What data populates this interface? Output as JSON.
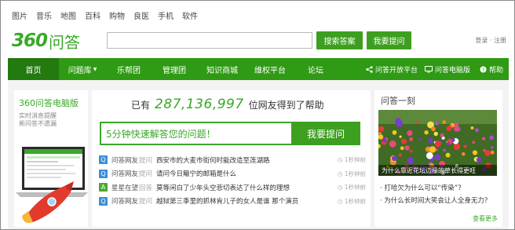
{
  "topnav": [
    "图片",
    "音乐",
    "地图",
    "百科",
    "购物",
    "良医",
    "手机",
    "软件"
  ],
  "logo": {
    "number": "360",
    "text": "问答"
  },
  "search_button": "搜索答案",
  "ask_button": "我要提问",
  "login": "登录 · 注册",
  "nav": {
    "home": "首页",
    "items": [
      "问题库",
      "乐帮团",
      "管理团",
      "知识商城",
      "维权平台",
      "论坛"
    ],
    "right": [
      "问答开放平台",
      "问答电脑版",
      "帮助"
    ]
  },
  "left": {
    "title": "360问答电脑版",
    "sub": "实时消息提醒\n新问答不遗漏"
  },
  "stats": {
    "prefix": "已有",
    "count": "287,136,997",
    "suffix": "位网友得到了帮助"
  },
  "ask_placeholder": "5分钟快速解答您的问题！",
  "ask_big": "我要提问",
  "questions": [
    {
      "tag": "Q",
      "user": "问答网友",
      "action": "提问",
      "title": "西安市的大麦市街何时能改造至莲湖路",
      "time": "1秒钟前",
      "color": "#3b8fd6"
    },
    {
      "tag": "Q",
      "user": "问答网友",
      "action": "提问",
      "title": "请问今日簸宁的邮箱是什么",
      "time": "1秒钟前",
      "color": "#3b8fd6"
    },
    {
      "tag": "A",
      "user": "星星在望",
      "action": "回答",
      "title": "莫等闲白了少年头空悲切表达了什么样的理想",
      "time": "1秒钟前",
      "color": "#4aa832"
    },
    {
      "tag": "Q",
      "user": "问答网友",
      "action": "提问",
      "title": "越狱第三季里的抓林肯儿子的女人是谁 那个演员",
      "time": "1秒钟前",
      "color": "#3b8fd6"
    }
  ],
  "right": {
    "title": "问答一刻",
    "caption": "为什么靠近花坛边缘的草长得更旺",
    "links": [
      "· 打哈欠为什么可以“传染”？",
      "· 为什么长时间大笑会让人全身无力？"
    ],
    "more": "查看更多"
  }
}
